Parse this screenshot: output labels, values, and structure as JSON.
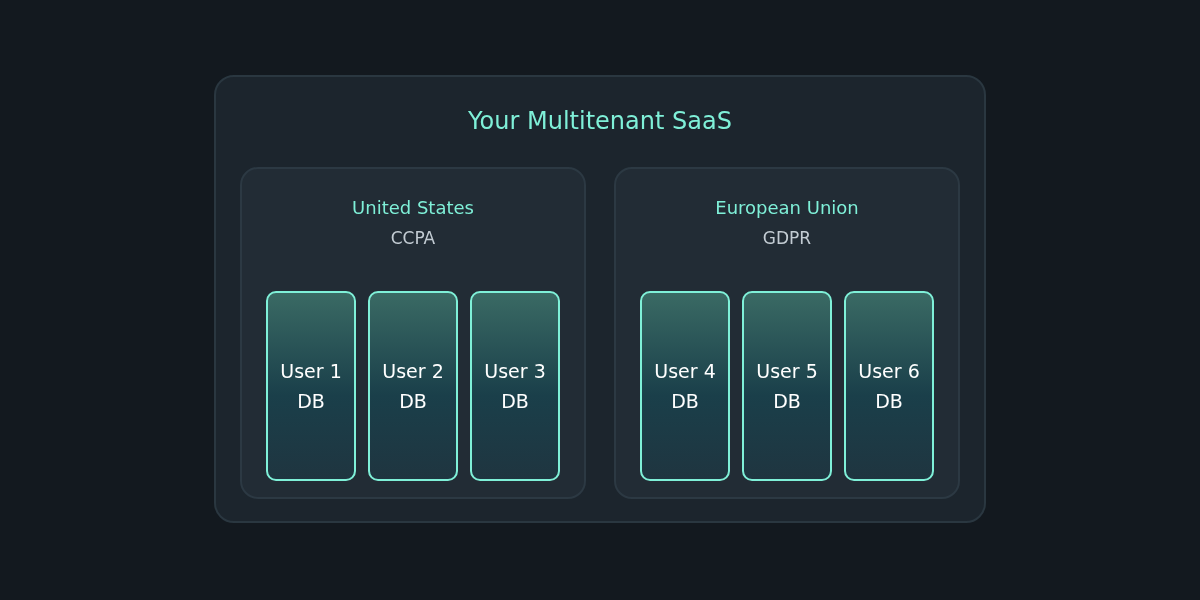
{
  "title": "Your Multitenant SaaS",
  "regions": [
    {
      "name": "United States",
      "regulation": "CCPA",
      "databases": [
        {
          "label": "User 1",
          "sublabel": "DB"
        },
        {
          "label": "User 2",
          "sublabel": "DB"
        },
        {
          "label": "User 3",
          "sublabel": "DB"
        }
      ]
    },
    {
      "name": "European Union",
      "regulation": "GDPR",
      "databases": [
        {
          "label": "User 4",
          "sublabel": "DB"
        },
        {
          "label": "User 5",
          "sublabel": "DB"
        },
        {
          "label": "User 6",
          "sublabel": "DB"
        }
      ]
    }
  ]
}
